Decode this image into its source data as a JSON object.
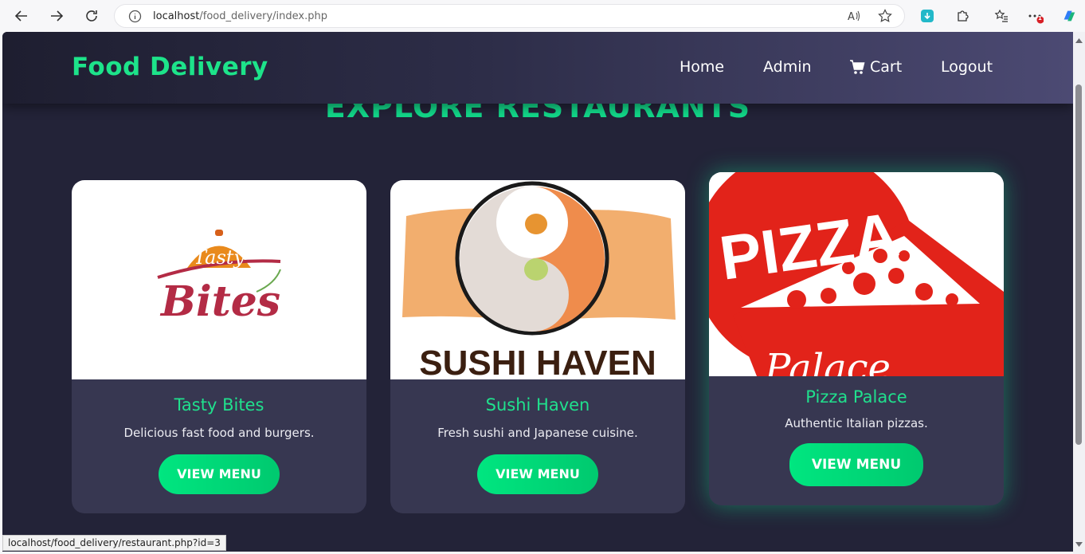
{
  "browser": {
    "url_host": "localhost",
    "url_path": "/food_delivery/index.php",
    "status_url": "localhost/food_delivery/restaurant.php?id=3",
    "notification_badge": "1"
  },
  "header": {
    "logo": "Food Delivery",
    "menu": {
      "home": "Home",
      "admin": "Admin",
      "cart": "Cart",
      "logout": "Logout"
    }
  },
  "main": {
    "title": "EXPLORE RESTAURANTS",
    "restaurants": [
      {
        "name": "Tasty Bites",
        "description": "Delicious fast food and burgers.",
        "button": "VIEW MENU",
        "logo_top": "Tasty",
        "logo_bottom": "Bites"
      },
      {
        "name": "Sushi Haven",
        "description": "Fresh sushi and Japanese cuisine.",
        "button": "VIEW MENU",
        "logo_text": "SUSHI HAVEN"
      },
      {
        "name": "Pizza Palace",
        "description": "Authentic Italian pizzas.",
        "button": "VIEW MENU",
        "logo_top": "PIZZA",
        "logo_bottom": "Palace"
      }
    ]
  },
  "colors": {
    "accent": "#1de38a",
    "page_bg": "#232338",
    "card_bg": "#373751"
  }
}
